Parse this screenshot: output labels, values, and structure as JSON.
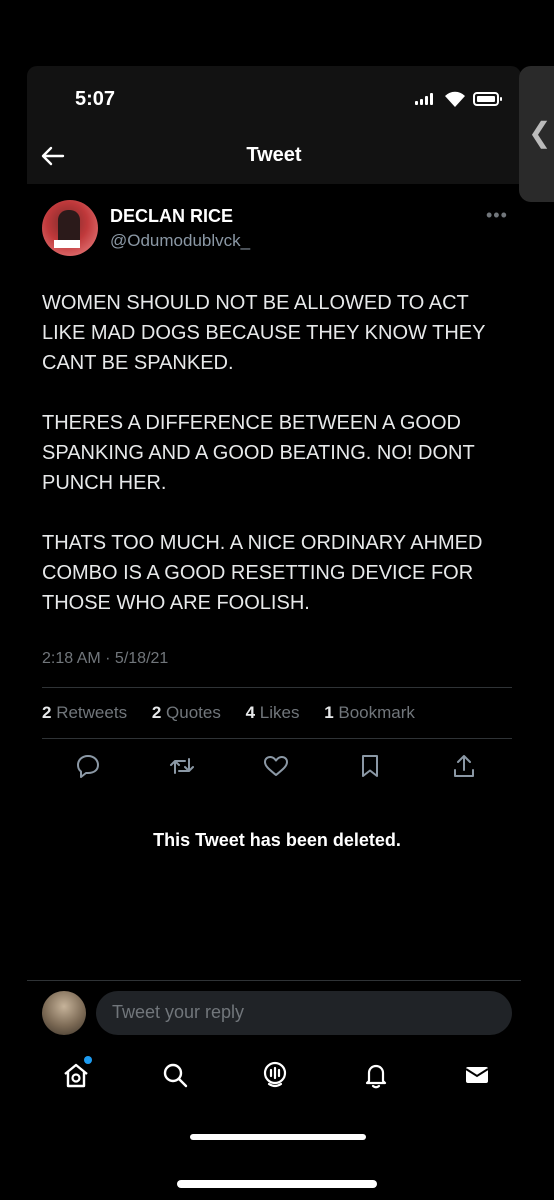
{
  "status_bar": {
    "time": "5:07"
  },
  "nav": {
    "title": "Tweet"
  },
  "tweet": {
    "display_name": "DECLAN RICE",
    "handle": "@Odumodublvck_",
    "paragraphs": [
      "WOMEN SHOULD NOT BE ALLOWED TO ACT LIKE MAD DOGS BECAUSE THEY KNOW THEY CANT BE SPANKED.",
      "THERES A DIFFERENCE BETWEEN A GOOD SPANKING AND A GOOD BEATING. NO! DONT PUNCH HER.",
      "THATS TOO MUCH. A NICE ORDINARY AHMED COMBO IS A GOOD RESETTING DEVICE FOR THOSE WHO ARE FOOLISH."
    ],
    "timestamp": "2:18 AM · 5/18/21",
    "stats": {
      "retweets_count": "2",
      "retweets_label": "Retweets",
      "quotes_count": "2",
      "quotes_label": "Quotes",
      "likes_count": "4",
      "likes_label": "Likes",
      "bookmarks_count": "1",
      "bookmarks_label": "Bookmark"
    }
  },
  "quoted": {
    "deleted_text": "This Tweet has been deleted."
  },
  "reply": {
    "placeholder": "Tweet your reply"
  },
  "icons": {
    "back": "arrow-left-icon",
    "reply": "comment-icon",
    "retweet": "retweet-icon",
    "like": "heart-icon",
    "bookmark": "bookmark-icon",
    "share": "share-icon",
    "home": "home-icon",
    "search": "search-icon",
    "spaces": "spaces-icon",
    "notifications": "bell-icon",
    "messages": "mail-icon"
  },
  "colors": {
    "accent": "#1d9bf0",
    "background": "#000000",
    "muted": "#71767b"
  }
}
